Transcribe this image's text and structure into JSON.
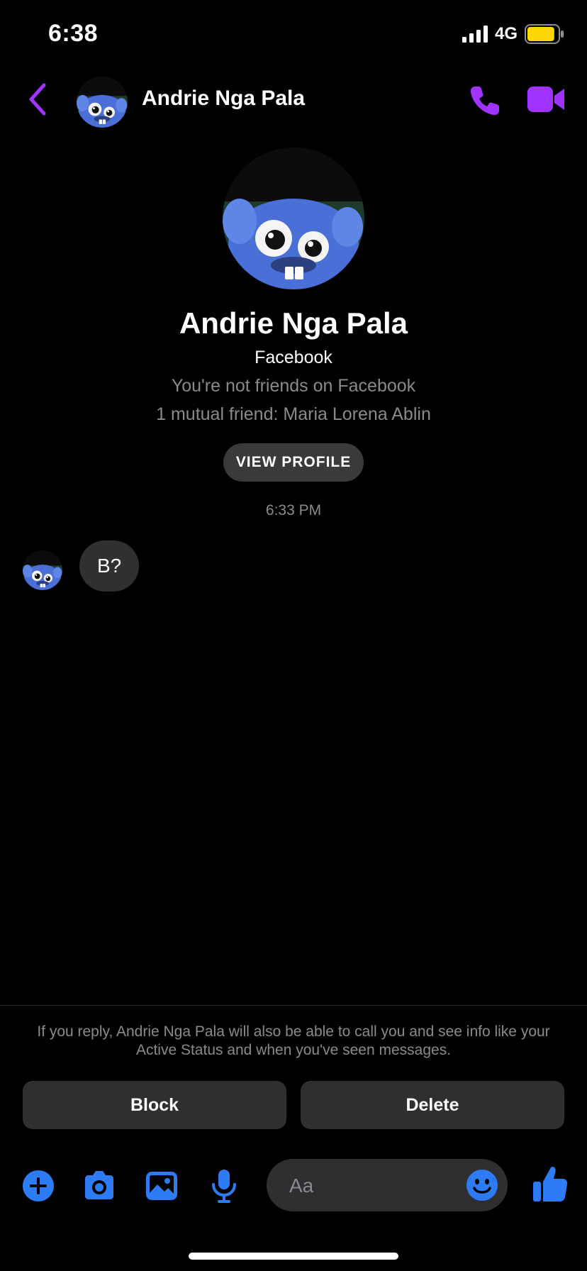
{
  "status_bar": {
    "time": "6:38",
    "network": "4G",
    "battery_level": 0.9,
    "battery_color": "#FFD60A"
  },
  "header": {
    "contact_name": "Andrie Nga Pala",
    "accent_color": "#A033FF",
    "icons": {
      "back": "chevron-left-icon",
      "call": "phone-icon",
      "video": "video-camera-icon"
    }
  },
  "profile": {
    "name": "Andrie Nga Pala",
    "source": "Facebook",
    "friend_status": "You're not friends on Facebook",
    "mutual_friends": "1 mutual friend: Maria Lorena Ablin",
    "view_profile_label": "VIEW PROFILE"
  },
  "conversation": {
    "timestamp": "6:33 PM",
    "messages": [
      {
        "text": "B?",
        "from": "contact"
      }
    ]
  },
  "request_notice": {
    "text": "If you reply, Andrie Nga Pala will also be able to call you and see info like your Active Status and when you've seen messages.",
    "block_label": "Block",
    "delete_label": "Delete"
  },
  "composer": {
    "placeholder": "Aa",
    "accent_color": "#2D7CF6",
    "icons": [
      "plus-icon",
      "camera-icon",
      "gallery-icon",
      "microphone-icon",
      "emoji-icon",
      "thumbs-up-icon"
    ]
  }
}
